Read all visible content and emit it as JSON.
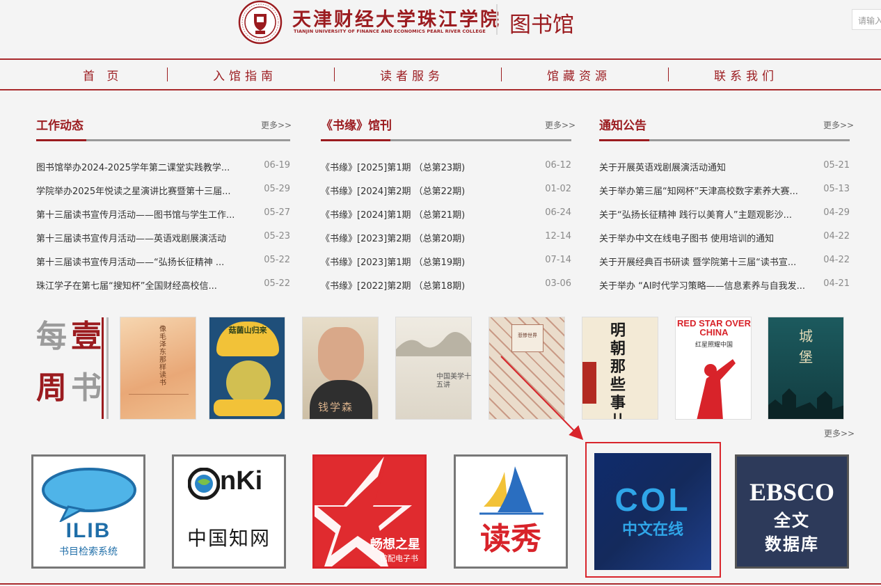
{
  "header": {
    "school_name_cn": "天津财经大学珠江学院",
    "school_name_en": "TIANJIN UNIVERSITY OF FINANCE AND ECONOMICS PEARL RIVER COLLEGE",
    "library_title": "图书馆",
    "search_placeholder": "请输入"
  },
  "nav": {
    "items": [
      "首 页",
      "入馆指南",
      "读者服务",
      "馆藏资源",
      "联系我们"
    ]
  },
  "news": {
    "work": {
      "title": "工作动态",
      "more": "更多>>",
      "items": [
        {
          "title": "图书馆举办2024-2025学年第二课堂实践教学...",
          "date": "06-19"
        },
        {
          "title": "学院举办2025年悦读之星演讲比赛暨第十三届...",
          "date": "05-29"
        },
        {
          "title": "第十三届读书宣传月活动——图书馆与学生工作...",
          "date": "05-27"
        },
        {
          "title": "第十三届读书宣传月活动——英语戏剧展演活动",
          "date": "05-23"
        },
        {
          "title": "第十三届读书宣传月活动——“弘扬长征精神 ...",
          "date": "05-22"
        },
        {
          "title": "珠江学子在第七届“搜知杯”全国财经高校信...",
          "date": "05-22"
        }
      ]
    },
    "journal": {
      "title": "《书缘》馆刊",
      "more": "更多>>",
      "items": [
        {
          "title": "《书缘》[2025]第1期 （总第23期)",
          "date": "06-12"
        },
        {
          "title": "《书缘》[2024]第2期 （总第22期)",
          "date": "01-02"
        },
        {
          "title": "《书缘》[2024]第1期 （总第21期)",
          "date": "06-24"
        },
        {
          "title": "《书缘》[2023]第2期 （总第20期)",
          "date": "12-14"
        },
        {
          "title": "《书缘》[2023]第1期 （总第19期)",
          "date": "07-14"
        },
        {
          "title": "《书缘》[2022]第2期 （总第18期)",
          "date": "03-06"
        }
      ]
    },
    "notice": {
      "title": "通知公告",
      "more": "更多>>",
      "items": [
        {
          "title": "关于开展英语戏剧展演活动通知",
          "date": "05-21"
        },
        {
          "title": "关于举办第三届“知网杯”天津高校数字素养大赛...",
          "date": "05-13"
        },
        {
          "title": "关于“弘扬长征精神 践行以美育人”主题观影沙...",
          "date": "04-29"
        },
        {
          "title": "关于举办中文在线电子图书 使用培训的通知",
          "date": "04-22"
        },
        {
          "title": "关于开展经典百书研读 暨学院第十三届“读书宣...",
          "date": "04-22"
        },
        {
          "title": "关于举办 “AI时代学习策略——信息素养与自我发...",
          "date": "04-21"
        }
      ]
    }
  },
  "weekly": {
    "label": [
      "每",
      "周",
      "壹",
      "书"
    ],
    "more": "更多>>",
    "books": [
      {
        "cover_text": "像毛泽东那样读书",
        "colors": [
          "#f0c9a0",
          "#e8b488"
        ]
      },
      {
        "cover_text": "菇菌山归来",
        "colors": [
          "#1f4f7a",
          "#f2c238"
        ]
      },
      {
        "cover_text": "钱学森",
        "colors": [
          "#d9cbb5",
          "#3a3a3a"
        ]
      },
      {
        "cover_text": "中国美学十五讲",
        "colors": [
          "#e8e2d6",
          "#7a7a6a"
        ]
      },
      {
        "cover_text": "悲惨世界",
        "colors": [
          "#eadccb",
          "#b07862"
        ]
      },
      {
        "cover_text": "明朝那些事儿",
        "colors": [
          "#f3ead6",
          "#1a1a1a"
        ]
      },
      {
        "cover_text": "RED STAR OVER CHINA",
        "subtitle": "红星照耀中国",
        "colors": [
          "#ffffff",
          "#d8232a"
        ]
      },
      {
        "cover_text": "城堡",
        "colors": [
          "#1c4c50",
          "#d6c79a"
        ]
      }
    ]
  },
  "databases": [
    {
      "name": "ILIB",
      "subtitle": "书目检索系统"
    },
    {
      "name": "CNKI",
      "subtitle": "中国知网"
    },
    {
      "name": "畅想之星",
      "subtitle": "馆配电子书"
    },
    {
      "name": "读秀",
      "subtitle": ""
    },
    {
      "name": "COL",
      "subtitle": "中文在线"
    },
    {
      "name": "EBSCO",
      "subtitle": "全文",
      "subtitle2": "数据库"
    }
  ],
  "colors": {
    "brand_red": "#9b1b1f",
    "highlight_red": "#d8242b"
  }
}
